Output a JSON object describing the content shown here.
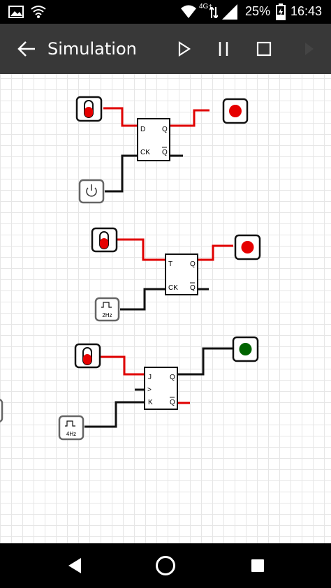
{
  "status_bar": {
    "network": "4G+",
    "battery": "25%",
    "time": "16:43"
  },
  "app_bar": {
    "title": "Simulation"
  },
  "circuits": {
    "d_flip_flop": {
      "input_d": "D",
      "input_ck": "CK",
      "output_q": "Q",
      "output_qbar": "Q"
    },
    "t_flip_flop": {
      "input_t": "T",
      "input_ck": "CK",
      "output_q": "Q",
      "output_qbar": "Q",
      "clock_label": "2Hz"
    },
    "jk_flip_flop": {
      "input_j": "J",
      "input_clk": ">",
      "input_k": "K",
      "output_q": "Q",
      "output_qbar": "Q",
      "clock_label": "4Hz"
    }
  },
  "colors": {
    "wire_high": "#e00000",
    "wire_low": "#111111",
    "led_on_red": "#e60000",
    "led_on_green": "#006400",
    "toolbar": "#383838"
  }
}
